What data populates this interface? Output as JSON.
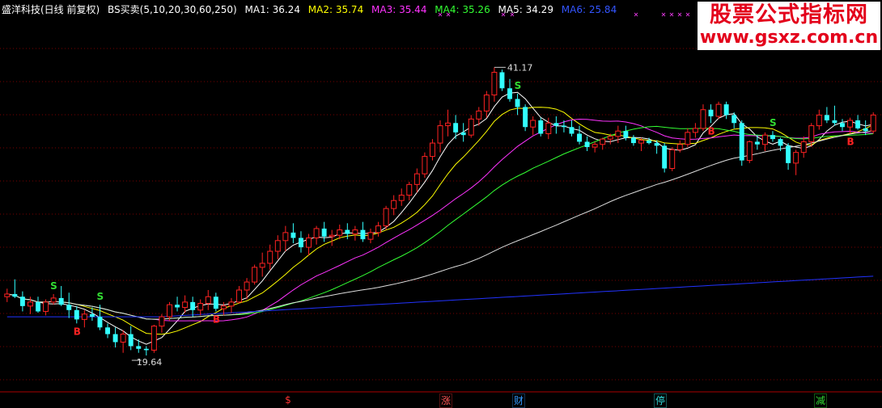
{
  "header": {
    "stock": "盛洋科技(日线 前复权)",
    "indicator": "BS买卖(5,10,20,30,60,250)",
    "ma": [
      {
        "label": "MA1: 36.24",
        "color": "#ffffff"
      },
      {
        "label": "MA2: 35.74",
        "color": "#ffff00"
      },
      {
        "label": "MA3: 35.44",
        "color": "#ff33ff"
      },
      {
        "label": "MA4: 35.26",
        "color": "#33ff33"
      },
      {
        "label": "MA5: 34.29",
        "color": "#ffffff"
      },
      {
        "label": "MA6: 25.84",
        "color": "#3355ff"
      }
    ]
  },
  "watermark": {
    "title": "股票公式指标网",
    "url": "www.gsxz.com.cn"
  },
  "bottom_tags": [
    {
      "label": "$",
      "color": "#ff3333"
    },
    {
      "label": "涨",
      "color": "#ff5555"
    },
    {
      "label": "财",
      "color": "#3399ff"
    },
    {
      "label": "停",
      "color": "#33dddd"
    },
    {
      "label": "减",
      "color": "#33dd33"
    }
  ],
  "chart_data": {
    "type": "candlestick",
    "ylim": [
      17,
      45
    ],
    "annotations": {
      "high_label": "41.17",
      "low_label": "19.64"
    },
    "signal_labels": [
      "S",
      "B"
    ],
    "candles": [
      [
        24.0,
        24.6,
        23.6,
        24.2
      ],
      [
        24.2,
        25.3,
        23.9,
        24.0
      ],
      [
        24.0,
        24.4,
        22.9,
        23.3
      ],
      [
        23.3,
        24.0,
        22.7,
        23.6
      ],
      [
        23.6,
        24.0,
        22.8,
        22.9
      ],
      [
        22.9,
        23.8,
        22.6,
        23.6
      ],
      [
        23.6,
        24.2,
        23.4,
        23.9
      ],
      [
        23.9,
        24.8,
        23.3,
        23.4
      ],
      [
        23.4,
        24.3,
        22.4,
        23.0
      ],
      [
        23.0,
        23.3,
        22.0,
        22.3
      ],
      [
        22.3,
        23.0,
        21.7,
        22.7
      ],
      [
        22.7,
        23.2,
        22.2,
        22.5
      ],
      [
        22.5,
        23.4,
        21.5,
        21.7
      ],
      [
        21.7,
        22.0,
        20.9,
        21.2
      ],
      [
        21.2,
        21.7,
        20.2,
        20.6
      ],
      [
        20.6,
        21.5,
        19.8,
        21.2
      ],
      [
        21.2,
        21.8,
        20.0,
        20.3
      ],
      [
        20.3,
        20.8,
        19.8,
        20.1
      ],
      [
        20.1,
        20.3,
        19.6,
        20.0
      ],
      [
        20.0,
        21.9,
        19.8,
        21.8
      ],
      [
        21.8,
        22.7,
        21.3,
        22.5
      ],
      [
        22.5,
        23.6,
        22.2,
        23.4
      ],
      [
        23.4,
        24.0,
        22.9,
        23.2
      ],
      [
        23.2,
        24.1,
        22.8,
        23.6
      ],
      [
        23.6,
        24.0,
        22.5,
        23.0
      ],
      [
        23.0,
        23.8,
        22.6,
        23.5
      ],
      [
        23.5,
        24.5,
        23.0,
        24.0
      ],
      [
        24.0,
        24.3,
        22.9,
        23.1
      ],
      [
        23.1,
        23.6,
        22.6,
        23.3
      ],
      [
        23.3,
        23.9,
        22.8,
        23.6
      ],
      [
        23.6,
        24.8,
        23.5,
        24.5
      ],
      [
        24.5,
        25.4,
        23.8,
        25.1
      ],
      [
        25.1,
        26.4,
        24.9,
        26.2
      ],
      [
        26.2,
        27.3,
        25.5,
        26.5
      ],
      [
        26.5,
        27.9,
        26.0,
        27.4
      ],
      [
        27.4,
        28.6,
        26.8,
        28.2
      ],
      [
        28.2,
        29.3,
        27.4,
        28.8
      ],
      [
        28.8,
        29.5,
        28.0,
        28.4
      ],
      [
        28.4,
        28.9,
        27.3,
        27.7
      ],
      [
        27.7,
        28.7,
        27.1,
        28.4
      ],
      [
        28.4,
        29.3,
        27.9,
        29.1
      ],
      [
        29.1,
        29.6,
        28.1,
        28.5
      ],
      [
        28.5,
        29.0,
        27.8,
        28.6
      ],
      [
        28.6,
        29.4,
        28.3,
        29.0
      ],
      [
        29.0,
        29.5,
        28.3,
        28.7
      ],
      [
        28.7,
        29.3,
        28.2,
        29.0
      ],
      [
        29.0,
        29.6,
        28.1,
        28.3
      ],
      [
        28.3,
        29.1,
        28.0,
        28.8
      ],
      [
        28.8,
        29.6,
        28.5,
        29.3
      ],
      [
        29.3,
        30.8,
        29.0,
        30.6
      ],
      [
        30.6,
        31.6,
        30.1,
        31.2
      ],
      [
        31.2,
        32.1,
        30.8,
        31.6
      ],
      [
        31.6,
        32.6,
        31.2,
        32.4
      ],
      [
        32.4,
        33.6,
        31.8,
        33.2
      ],
      [
        33.2,
        34.8,
        32.9,
        34.5
      ],
      [
        34.5,
        35.8,
        34.2,
        35.5
      ],
      [
        35.5,
        37.2,
        34.8,
        36.8
      ],
      [
        36.8,
        38.0,
        36.0,
        37.0
      ],
      [
        37.0,
        37.6,
        35.8,
        36.3
      ],
      [
        36.3,
        37.0,
        35.6,
        36.1
      ],
      [
        36.1,
        37.6,
        35.9,
        37.3
      ],
      [
        37.3,
        38.2,
        36.8,
        37.9
      ],
      [
        37.9,
        39.4,
        37.4,
        39.1
      ],
      [
        39.1,
        41.17,
        38.6,
        40.8
      ],
      [
        40.8,
        41.0,
        39.4,
        39.6
      ],
      [
        39.6,
        40.3,
        38.6,
        38.8
      ],
      [
        38.8,
        39.2,
        37.6,
        38.2
      ],
      [
        38.2,
        38.4,
        36.4,
        36.7
      ],
      [
        36.7,
        37.5,
        36.1,
        37.2
      ],
      [
        37.2,
        37.4,
        36.0,
        36.2
      ],
      [
        36.2,
        37.4,
        35.8,
        37.0
      ],
      [
        37.0,
        37.5,
        36.2,
        36.8
      ],
      [
        36.8,
        37.2,
        36.3,
        36.7
      ],
      [
        36.7,
        37.2,
        36.0,
        36.2
      ],
      [
        36.2,
        36.8,
        35.4,
        35.6
      ],
      [
        35.6,
        36.0,
        34.9,
        35.2
      ],
      [
        35.2,
        35.6,
        34.8,
        35.4
      ],
      [
        35.4,
        35.9,
        35.0,
        35.8
      ],
      [
        35.8,
        36.2,
        35.4,
        36.0
      ],
      [
        36.0,
        36.8,
        35.5,
        36.4
      ],
      [
        36.4,
        36.8,
        35.7,
        35.9
      ],
      [
        35.9,
        36.1,
        35.3,
        35.5
      ],
      [
        35.5,
        35.9,
        34.9,
        35.7
      ],
      [
        35.7,
        35.9,
        35.4,
        35.5
      ],
      [
        35.5,
        35.7,
        34.7,
        35.3
      ],
      [
        35.3,
        35.5,
        33.3,
        33.6
      ],
      [
        33.6,
        35.2,
        33.4,
        35.0
      ],
      [
        35.0,
        35.7,
        34.8,
        35.4
      ],
      [
        35.4,
        36.6,
        35.2,
        36.3
      ],
      [
        36.3,
        37.0,
        35.9,
        36.6
      ],
      [
        36.6,
        38.4,
        36.4,
        38.0
      ],
      [
        38.0,
        38.4,
        37.0,
        37.5
      ],
      [
        37.5,
        38.6,
        37.3,
        38.4
      ],
      [
        38.4,
        38.6,
        37.3,
        37.6
      ],
      [
        37.6,
        37.8,
        36.6,
        37.0
      ],
      [
        37.0,
        37.2,
        33.8,
        34.2
      ],
      [
        34.2,
        35.7,
        34.0,
        35.6
      ],
      [
        35.6,
        36.1,
        35.0,
        35.4
      ],
      [
        35.4,
        36.3,
        34.9,
        36.1
      ],
      [
        36.1,
        36.4,
        35.6,
        35.8
      ],
      [
        35.8,
        35.9,
        34.9,
        35.3
      ],
      [
        35.3,
        35.5,
        33.5,
        34.0
      ],
      [
        34.0,
        35.0,
        33.1,
        34.8
      ],
      [
        34.8,
        36.0,
        34.4,
        35.6
      ],
      [
        35.6,
        37.0,
        35.2,
        36.8
      ],
      [
        36.8,
        38.0,
        36.5,
        37.6
      ],
      [
        37.6,
        38.2,
        37.0,
        37.2
      ],
      [
        37.2,
        38.3,
        36.8,
        37.0
      ],
      [
        37.0,
        37.3,
        36.4,
        36.7
      ],
      [
        36.7,
        37.4,
        36.2,
        37.2
      ],
      [
        37.2,
        37.6,
        36.5,
        36.6
      ],
      [
        36.6,
        37.2,
        36.1,
        36.4
      ],
      [
        36.4,
        37.8,
        36.2,
        37.6
      ]
    ]
  }
}
